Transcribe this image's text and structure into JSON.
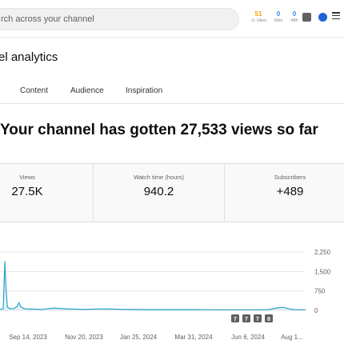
{
  "header": {
    "search_placeholder": "rch across your channel",
    "stats": [
      {
        "value": "51",
        "label": "1Ano",
        "color": "#f2a900"
      },
      {
        "value": "0",
        "label": "60m",
        "color": "#3b82f6"
      },
      {
        "value": "0",
        "label": "48h",
        "color": "#3b82f6"
      }
    ]
  },
  "page": {
    "title": "el analytics"
  },
  "tabs": [
    {
      "label": "Content"
    },
    {
      "label": "Audience"
    },
    {
      "label": "Inspiration"
    }
  ],
  "headline": "Your channel has gotten 27,533 views so far",
  "metrics": [
    {
      "label": "Views",
      "value": "27.5K"
    },
    {
      "label": "Watch time (hours)",
      "value": "940.2"
    },
    {
      "label": "Subscribers",
      "value": "+489"
    }
  ],
  "chart_data": {
    "type": "line",
    "x_tick_labels": [
      "Sep 14, 2023",
      "Nov 20, 2023",
      "Jan 25, 2024",
      "Mar 31, 2024",
      "Jun 6, 2024",
      "Aug 1..."
    ],
    "y_tick_labels": [
      "2,250",
      "1,500",
      "750",
      "0"
    ],
    "ylim": [
      0,
      2250
    ],
    "series": [
      {
        "color": "#2ba3c4",
        "points": [
          [
            "2023-07-01",
            900
          ],
          [
            "2023-07-04",
            300
          ],
          [
            "2023-07-07",
            150
          ],
          [
            "2023-07-10",
            300
          ],
          [
            "2023-07-12",
            500
          ],
          [
            "2023-07-14",
            2100
          ],
          [
            "2023-07-15",
            600
          ],
          [
            "2023-07-17",
            200
          ],
          [
            "2023-07-20",
            50
          ],
          [
            "2023-07-25",
            40
          ],
          [
            "2023-07-30",
            40
          ],
          [
            "2023-08-05",
            40
          ],
          [
            "2023-08-10",
            40
          ],
          [
            "2023-08-15",
            60
          ],
          [
            "2023-08-17",
            1900
          ],
          [
            "2023-08-18",
            1050
          ],
          [
            "2023-08-20",
            120
          ],
          [
            "2023-08-24",
            60
          ],
          [
            "2023-08-28",
            70
          ],
          [
            "2023-09-01",
            160
          ],
          [
            "2023-09-03",
            300
          ],
          [
            "2023-09-05",
            150
          ],
          [
            "2023-09-08",
            80
          ],
          [
            "2023-09-12",
            60
          ],
          [
            "2023-09-20",
            50
          ],
          [
            "2023-10-01",
            40
          ],
          [
            "2023-10-15",
            90
          ],
          [
            "2023-11-01",
            60
          ],
          [
            "2023-11-20",
            40
          ],
          [
            "2023-12-15",
            60
          ],
          [
            "2024-01-10",
            40
          ],
          [
            "2024-02-05",
            30
          ],
          [
            "2024-03-01",
            30
          ],
          [
            "2024-04-01",
            30
          ],
          [
            "2024-05-01",
            25
          ],
          [
            "2024-06-01",
            25
          ],
          [
            "2024-06-20",
            25
          ],
          [
            "2024-07-01",
            30
          ],
          [
            "2024-07-10",
            90
          ],
          [
            "2024-07-18",
            120
          ],
          [
            "2024-07-26",
            60
          ],
          [
            "2024-08-01",
            30
          ],
          [
            "2024-08-15",
            25
          ]
        ]
      }
    ],
    "annotations": [
      "7",
      "7",
      "7",
      "8"
    ]
  }
}
